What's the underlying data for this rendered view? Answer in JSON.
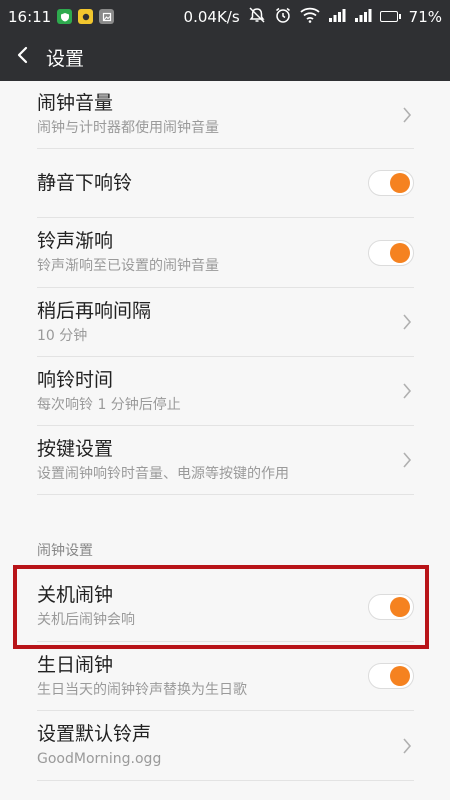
{
  "status_bar": {
    "time": "16:11",
    "network_speed": "0.04K/s",
    "battery_percent": "71%",
    "battery_level": 0.71,
    "notification_icons": [
      "app-shield-icon",
      "app-yellow-icon",
      "app-gallery-icon"
    ],
    "system_icons": [
      "mute-icon",
      "alarm-clock-icon",
      "wifi-icon",
      "signal-icon",
      "signal-icon",
      "battery-icon"
    ]
  },
  "header": {
    "title": "设置",
    "back_icon": "back-arrow-icon"
  },
  "settings": {
    "items": [
      {
        "title": "闹钟音量",
        "subtitle": "闹钟与计时器都使用闹钟音量",
        "control": "chevron"
      },
      {
        "title": "静音下响铃",
        "subtitle": "",
        "control": "toggle",
        "on": true
      },
      {
        "title": "铃声渐响",
        "subtitle": "铃声渐响至已设置的闹钟音量",
        "control": "toggle",
        "on": true
      },
      {
        "title": "稍后再响间隔",
        "subtitle": "10 分钟",
        "control": "chevron"
      },
      {
        "title": "响铃时间",
        "subtitle": "每次响铃 1 分钟后停止",
        "control": "chevron"
      },
      {
        "title": "按键设置",
        "subtitle": "设置闹钟响铃时音量、电源等按键的作用",
        "control": "chevron"
      }
    ]
  },
  "alarm_section": {
    "header": "闹钟设置",
    "items": [
      {
        "title": "关机闹钟",
        "subtitle": "关机后闹钟会响",
        "control": "toggle",
        "on": true,
        "highlighted": true
      },
      {
        "title": "生日闹钟",
        "subtitle": "生日当天的闹钟铃声替换为生日歌",
        "control": "toggle",
        "on": true
      },
      {
        "title": "设置默认铃声",
        "subtitle": "GoodMorning.ogg",
        "control": "chevron"
      }
    ]
  },
  "colors": {
    "title_bar": "#2f3033",
    "toggle_accent": "#f58220",
    "highlight_border": "#b81419"
  }
}
